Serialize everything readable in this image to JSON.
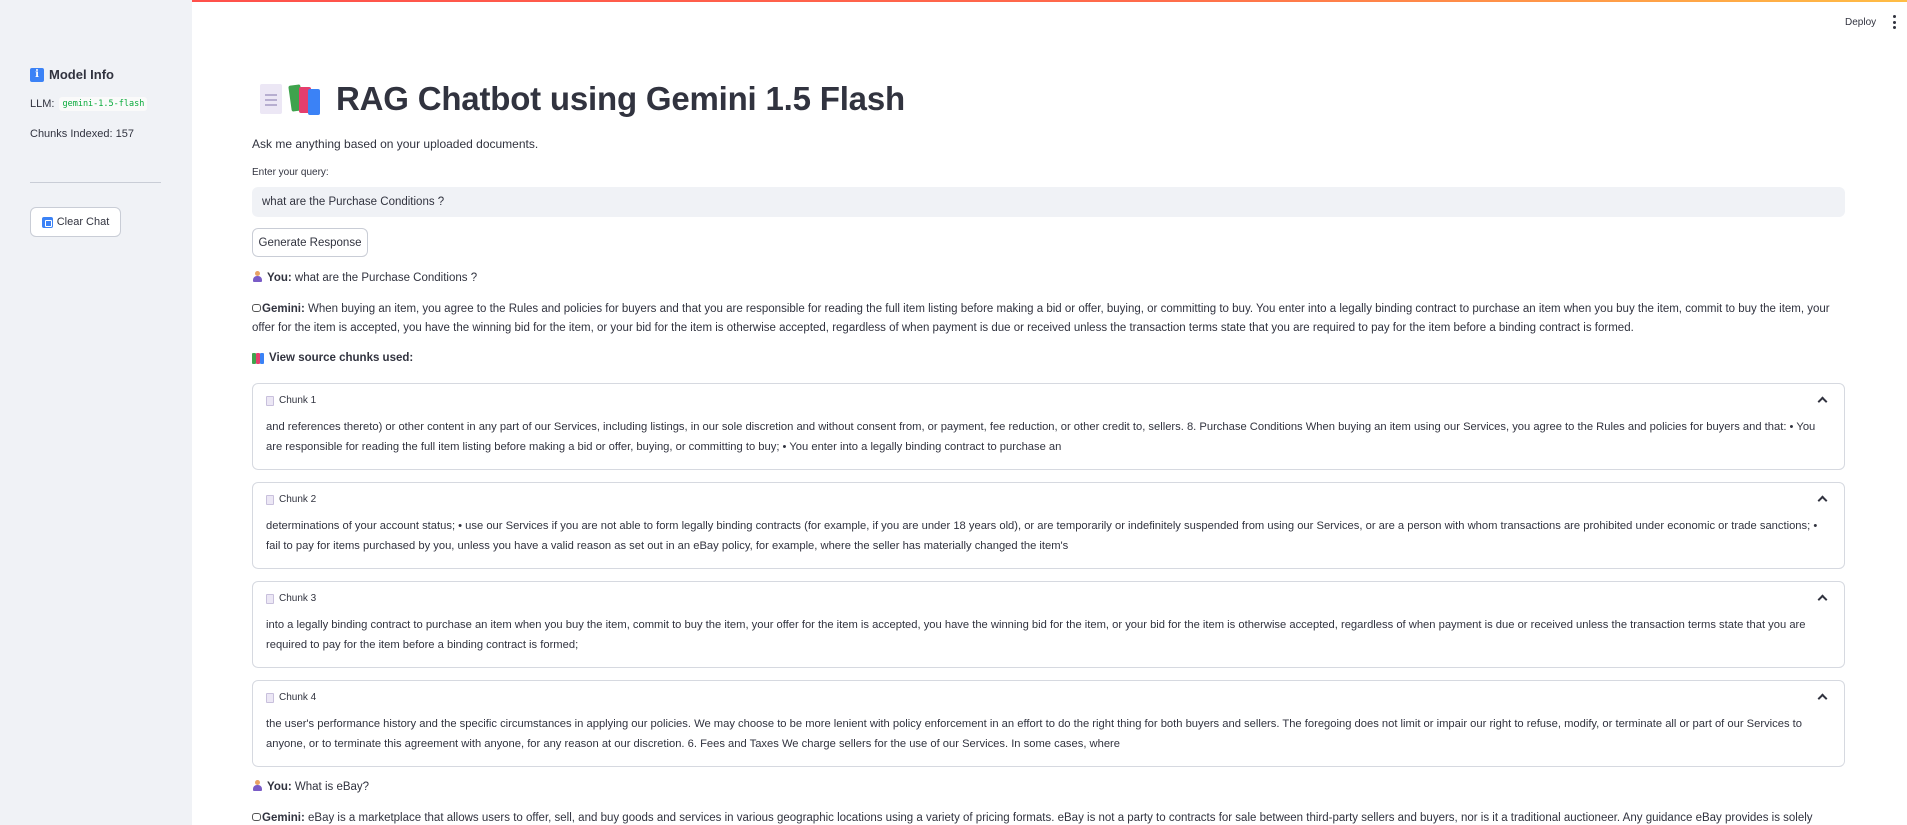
{
  "header": {
    "deploy_label": "Deploy"
  },
  "sidebar": {
    "title": "Model Info",
    "llm_label": "LLM:",
    "llm_value": "gemini-1.5-flash",
    "chunks_indexed": "Chunks Indexed: 157",
    "clear_label": "Clear Chat"
  },
  "main": {
    "title": "RAG Chatbot using Gemini 1.5 Flash",
    "subtitle": "Ask me anything based on your uploaded documents.",
    "query_label": "Enter your query:",
    "query_value": "what are the Purchase Conditions ?",
    "generate_label": "Generate Response"
  },
  "chat": [
    {
      "user_label": "You:",
      "user_text": "what are the Purchase Conditions ?",
      "bot_label": "Gemini:",
      "bot_text": "When buying an item, you agree to the Rules and policies for buyers and that you are responsible for reading the full item listing before making a bid or offer, buying, or committing to buy. You enter into a legally binding contract to purchase an item when you buy the item, commit to buy the item, your offer for the item is accepted, you have the winning bid for the item, or your bid for the item is otherwise accepted, regardless of when payment is due or received unless the transaction terms state that you are required to pay for the item before a binding contract is formed.",
      "sources_label": "View source chunks used:",
      "chunks": [
        {
          "title": "Chunk 1",
          "text": "and references thereto) or other content in any part of our Services, including listings, in our sole discretion and without consent from, or payment, fee reduction, or other credit to, sellers. 8. Purchase Conditions When buying an item using our Services, you agree to the Rules and policies for buyers and that: • You are responsible for reading the full item listing before making a bid or offer, buying, or committing to buy; • You enter into a legally binding contract to purchase an"
        },
        {
          "title": "Chunk 2",
          "text": "determinations of your account status; • use our Services if you are not able to form legally binding contracts (for example, if you are under 18 years old), or are temporarily or indefinitely suspended from using our Services, or are a person with whom transactions are prohibited under economic or trade sanctions; • fail to pay for items purchased by you, unless you have a valid reason as set out in an eBay policy, for example, where the seller has materially changed the item's"
        },
        {
          "title": "Chunk 3",
          "text": "into a legally binding contract to purchase an item when you buy the item, commit to buy the item, your offer for the item is accepted, you have the winning bid for the item, or your bid for the item is otherwise accepted, regardless of when payment is due or received unless the transaction terms state that you are required to pay for the item before a binding contract is formed;"
        },
        {
          "title": "Chunk 4",
          "text": "the user's performance history and the specific circumstances in applying our policies. We may choose to be more lenient with policy enforcement in an effort to do the right thing for both buyers and sellers. The foregoing does not limit or impair our right to refuse, modify, or terminate all or part of our Services to anyone, or to terminate this agreement with anyone, for any reason at our discretion. 6. Fees and Taxes We charge sellers for the use of our Services. In some cases, where"
        }
      ]
    },
    {
      "user_label": "You:",
      "user_text": "What is eBay?",
      "bot_label": "Gemini:",
      "bot_text": "eBay is a marketplace that allows users to offer, sell, and buy goods and services in various geographic locations using a variety of pricing formats. eBay is not a party to contracts for sale between third-party sellers and buyers, nor is it a traditional auctioneer. Any guidance eBay provides is solely informational."
    }
  ]
}
